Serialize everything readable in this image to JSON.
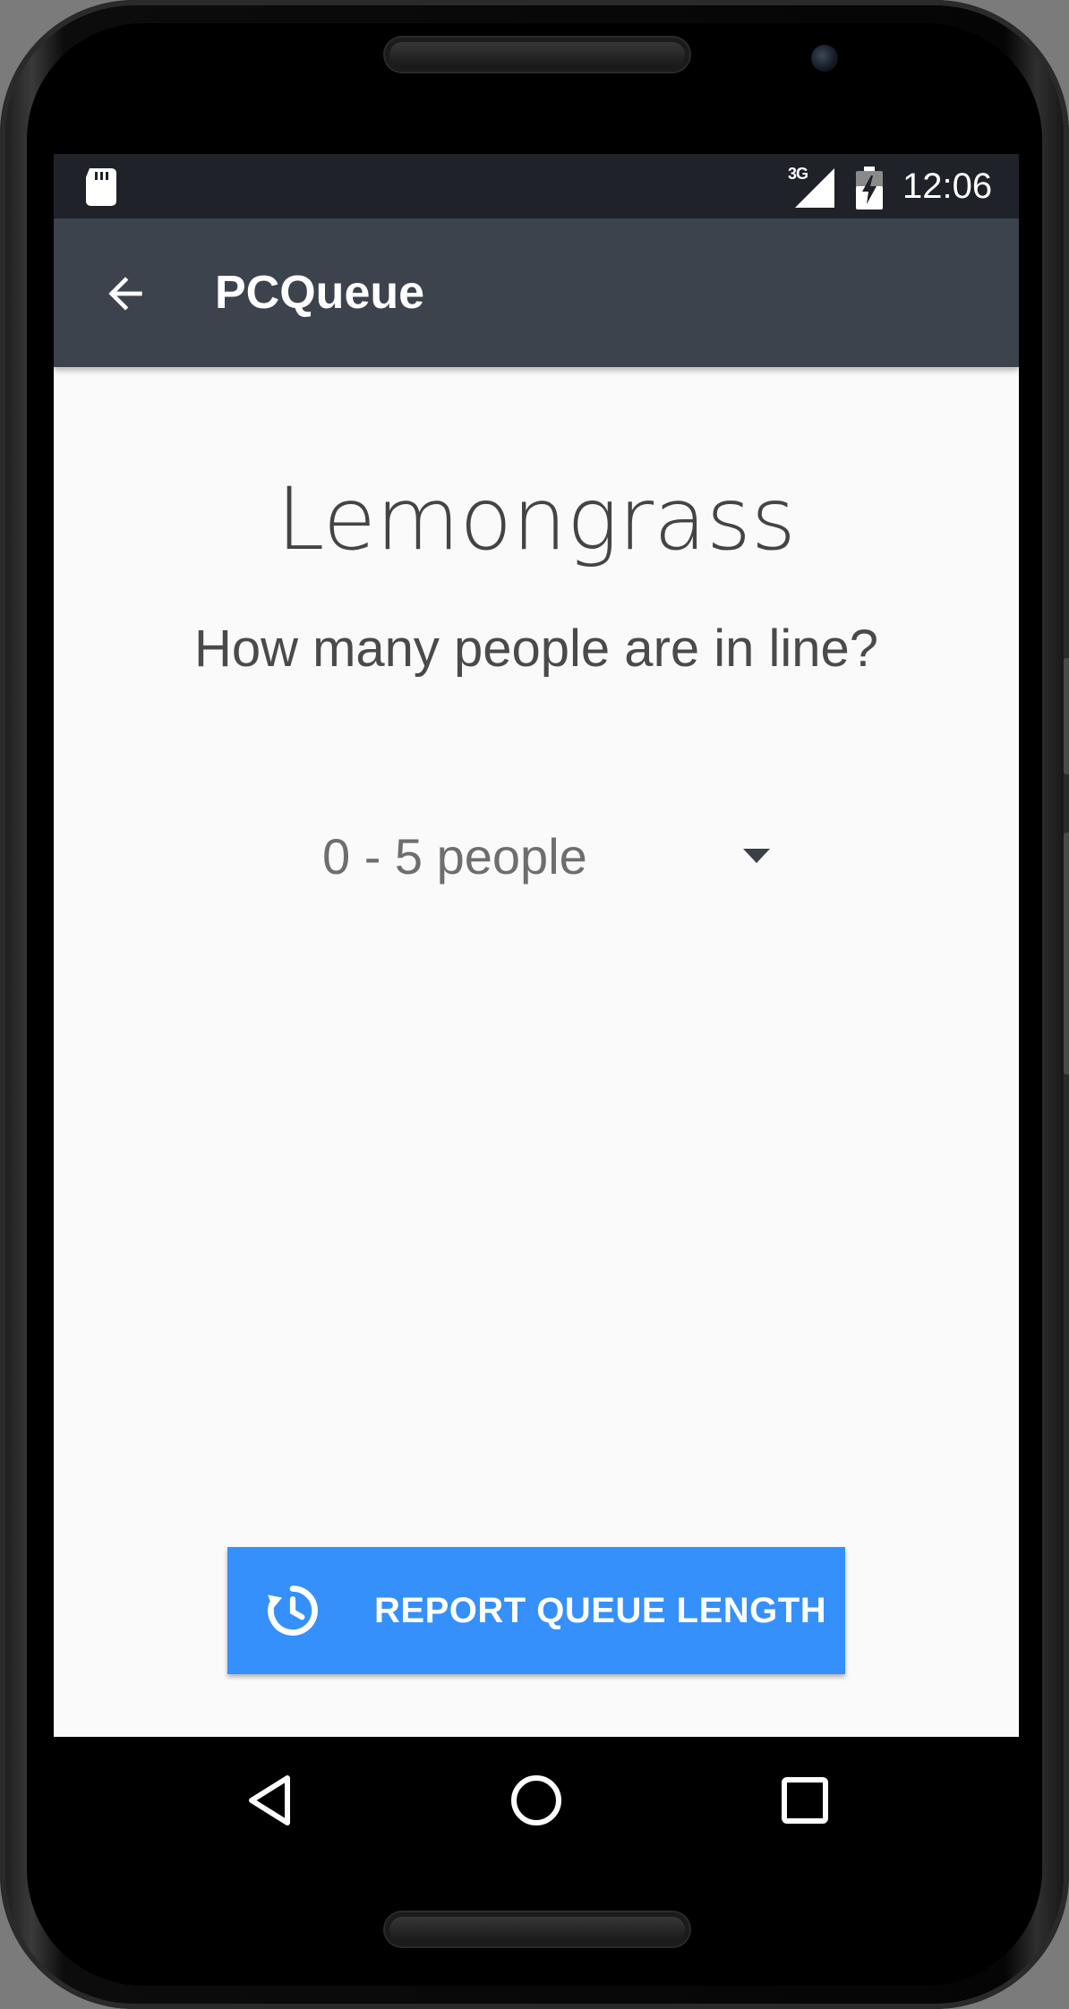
{
  "status_bar": {
    "network_type": "3G",
    "time": "12:06",
    "icons": [
      "sd-card-icon",
      "signal-icon",
      "battery-icon"
    ]
  },
  "app_bar": {
    "title": "PCQueue",
    "back_icon": "arrow-back-icon",
    "background_color": "#3c434d"
  },
  "main": {
    "place_name": "Lemongrass",
    "question": "How many people are in line?",
    "dropdown": {
      "selected": "0 - 5 people",
      "icon": "dropdown-arrow-icon"
    },
    "report_button": {
      "label": "REPORT QUEUE LENGTH",
      "icon": "history-clock-icon",
      "color": "#3590fc"
    }
  },
  "nav_bar": {
    "buttons": [
      "back-triangle-icon",
      "home-circle-icon",
      "recents-square-icon"
    ]
  }
}
